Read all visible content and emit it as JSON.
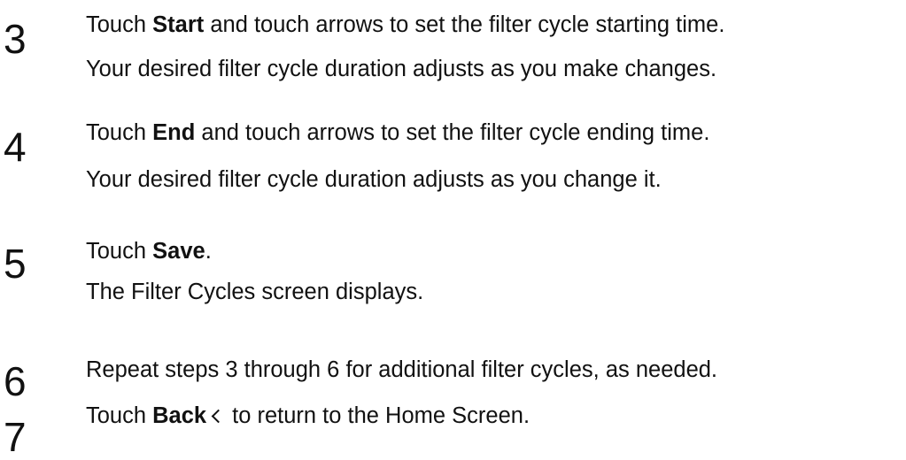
{
  "steps": [
    {
      "number": "3",
      "line1_pre": "Touch ",
      "line1_bold": "Start",
      "line1_post": " and touch arrows to set the filter cycle starting time.",
      "line2": "Your desired filter cycle duration adjusts as you make changes."
    },
    {
      "number": "4",
      "line1_pre": "Touch ",
      "line1_bold": "End",
      "line1_post": " and touch arrows to set the filter cycle ending time.",
      "line2": "Your desired filter cycle duration adjusts as you change it."
    },
    {
      "number": "5",
      "line1_pre": "Touch ",
      "line1_bold": "Save",
      "line1_post": ".",
      "line2": "The Filter Cycles screen displays."
    },
    {
      "number": "6",
      "line1": "Repeat steps 3 through 6 for additional filter cycles, as needed."
    },
    {
      "number": "7",
      "line1_pre": "Touch ",
      "line1_bold": "Back",
      "icon": "chevron-left-icon",
      "line1_post": "to return to the Home Screen."
    }
  ]
}
